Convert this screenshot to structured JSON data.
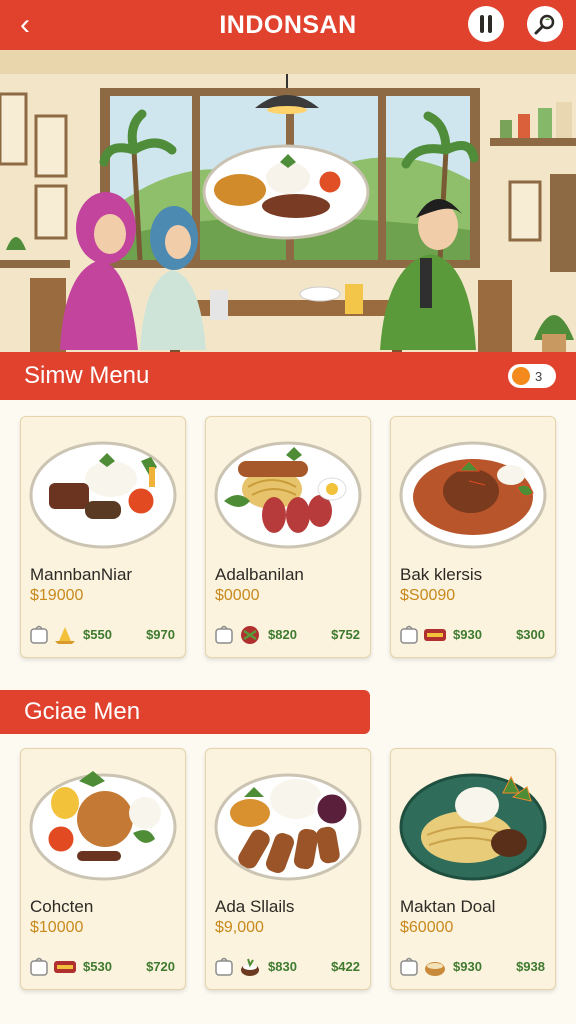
{
  "app": {
    "title": "INDONSAN"
  },
  "section1": {
    "title": "Simw Menu",
    "toggle_value": "3"
  },
  "section2": {
    "title": "Gciae Men"
  },
  "menu1": [
    {
      "name": "MannbanNiar",
      "price": "$19000",
      "price_a": "$550",
      "price_b": "$970"
    },
    {
      "name": "Adalbanilan",
      "price": "$0000",
      "price_a": "$820",
      "price_b": "$752"
    },
    {
      "name": "Bak klersis",
      "price": "$S0090",
      "price_a": "$930",
      "price_b": "$300"
    }
  ],
  "menu2": [
    {
      "name": "Cohcten",
      "price": "$10000",
      "price_a": "$530",
      "price_b": "$720"
    },
    {
      "name": "Ada Sllails",
      "price": "$9,000",
      "price_a": "$830",
      "price_b": "$422"
    },
    {
      "name": "Maktan Doal",
      "price": "$60000",
      "price_a": "$930",
      "price_b": "$938"
    }
  ],
  "icons": {
    "back": "chevron-left-icon",
    "menu": "utensils-icon",
    "search": "search-icon",
    "bag": "shopping-bag-icon",
    "dish": "bowl-icon"
  },
  "colors": {
    "primary": "#e0422e",
    "card_bg": "#fbf3dd",
    "price": "#c8891d",
    "accent_green": "#3e7a2f",
    "toggle": "#f28a1d"
  }
}
